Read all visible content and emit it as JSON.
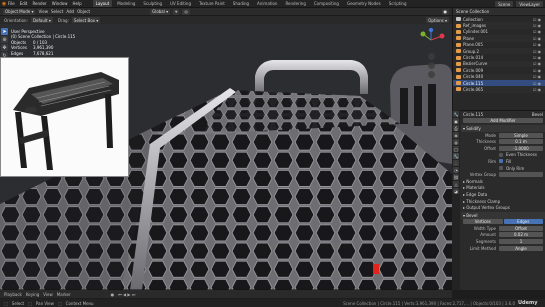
{
  "topbar": {
    "menu": [
      "File",
      "Edit",
      "Render",
      "Window",
      "Help"
    ],
    "tabs": [
      "Layout",
      "Modeling",
      "Sculpting",
      "UV Editing",
      "Texture Paint",
      "Shading",
      "Animation",
      "Rendering",
      "Compositing",
      "Geometry Nodes",
      "Scripting"
    ],
    "scene": "Scene",
    "view_layer": "ViewLayer"
  },
  "header": {
    "mode": "Object Mode",
    "view": "View",
    "select": "Select",
    "add": "Add",
    "object": "Object",
    "global": "Global"
  },
  "subheader": {
    "orientation_label": "Orientation:",
    "orientation_value": "Default",
    "drag_label": "Drag:",
    "drag_value": "Select Box",
    "options": "Options"
  },
  "overlay": {
    "view_name": "User Perspective",
    "collection": "(0) Scene Collection | Circle.115",
    "stats": [
      {
        "label": "Objects",
        "value": "0 / 103"
      },
      {
        "label": "Vertices",
        "value": "3,961,390"
      },
      {
        "label": "Edges",
        "value": "7,678,621"
      }
    ]
  },
  "toolbar": [
    "cursor",
    "move",
    "rotate",
    "scale",
    "transform",
    "annotate",
    "measure",
    "add-cube"
  ],
  "outliner": {
    "title": "Scene Collection",
    "rows": [
      "Collection",
      "Ref_images",
      "Cylinder.001",
      "Plane",
      "Plane.005",
      "Group.2",
      "Circle.014",
      "BezierCurve",
      "Circle.009",
      "Circle.040",
      "Circle.115",
      "Circle.065"
    ]
  },
  "properties": {
    "object_name": "Circle.115",
    "modifier_label": "Bevel",
    "add_modifier": "Add Modifier",
    "solidify": {
      "name": "Solidify",
      "mode_label": "Mode",
      "mode_value": "Simple",
      "thickness_label": "Thickness",
      "thickness_value": "0.1 m",
      "offset_label": "Offset",
      "offset_value": "-1.0000",
      "even_thickness": "Even Thickness",
      "rim_label": "Rim",
      "rim_fill": "Fill",
      "only_rim": "Only Rim",
      "vertex_group": "Vertex Group"
    },
    "sections": [
      "Normals",
      "Materials",
      "Edge Data",
      "Thickness Clamp",
      "Output Vertex Groups"
    ],
    "bevel": {
      "name": "Bevel",
      "tabs": [
        "Vertices",
        "Edges"
      ],
      "width_type_label": "Width Type",
      "width_type_value": "Offset",
      "amount_label": "Amount",
      "amount_value": "0.02 m",
      "segments_label": "Segments",
      "segments_value": "1",
      "limit_method_label": "Limit Method",
      "limit_method_value": "Angle"
    }
  },
  "timeline": {
    "playback": "Playback",
    "keying": "Keying",
    "view": "View",
    "marker": "Marker"
  },
  "status": {
    "select": "Select",
    "pan_view": "Pan View",
    "context_menu": "Context Menu",
    "info": "Scene Collection | Circle.115 | Verts:3,961,390 | Faces:2,717,... | Objects:0/103 | 3.6.0"
  },
  "watermark": "Udemy",
  "colors": {
    "accent": "#4772b3",
    "blender_orange": "#e87d0d",
    "selected_row": "#334d80"
  }
}
